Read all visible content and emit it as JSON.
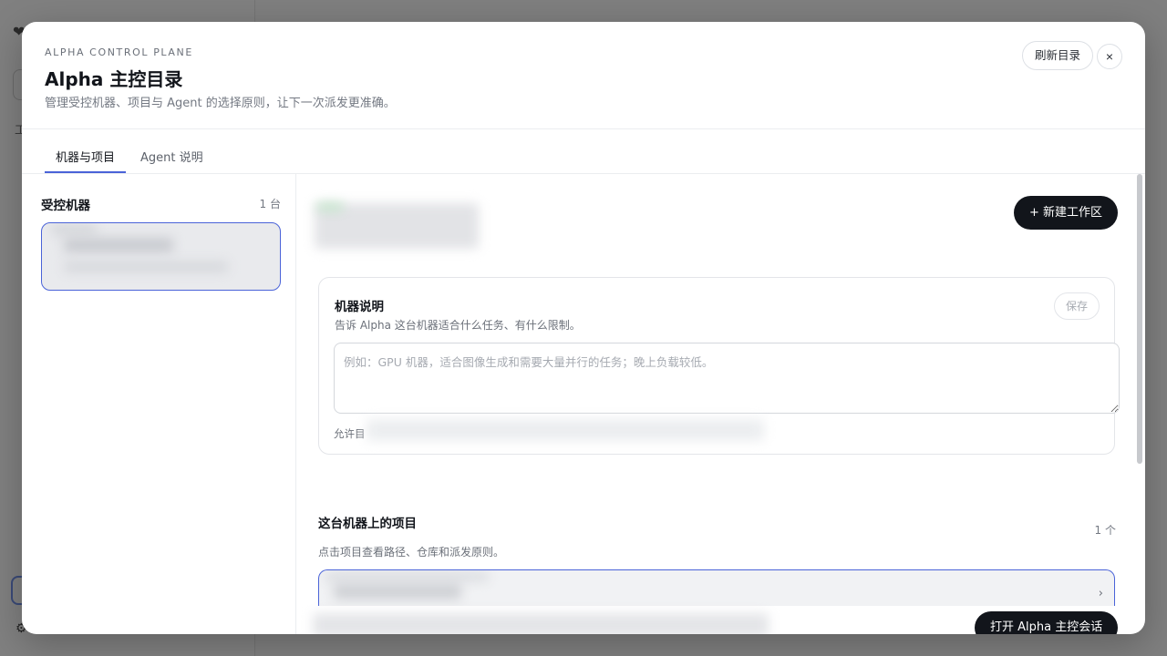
{
  "modal": {
    "eyebrow": "ALPHA CONTROL PLANE",
    "title": "Alpha 主控目录",
    "subtitle": "管理受控机器、项目与 Agent 的选择原则，让下一次派发更准确。",
    "refresh_label": "刷新目录",
    "close_label": "×"
  },
  "tabs": [
    {
      "label": "机器与项目",
      "active": true
    },
    {
      "label": "Agent 说明",
      "active": false
    }
  ],
  "machines_panel": {
    "title": "受控机器",
    "count": "1 台"
  },
  "toolbar": {
    "new_workspace_label": "+ 新建工作区"
  },
  "machine_description": {
    "title": "机器说明",
    "subtitle": "告诉 Alpha 这台机器适合什么任务、有什么限制。",
    "save_label": "保存",
    "placeholder": "例如：GPU 机器，适合图像生成和需要大量并行的任务；晚上负载较低。",
    "allowed_label": "允许目"
  },
  "projects": {
    "title": "这台机器上的项目",
    "count": "1 个",
    "subtitle": "点击项目查看路径、仓库和派发原则。"
  },
  "footer": {
    "open_session_label": "打开 Alpha 主控会话"
  },
  "colors": {
    "accent": "#4a63d8",
    "primary_button": "#12151b"
  }
}
